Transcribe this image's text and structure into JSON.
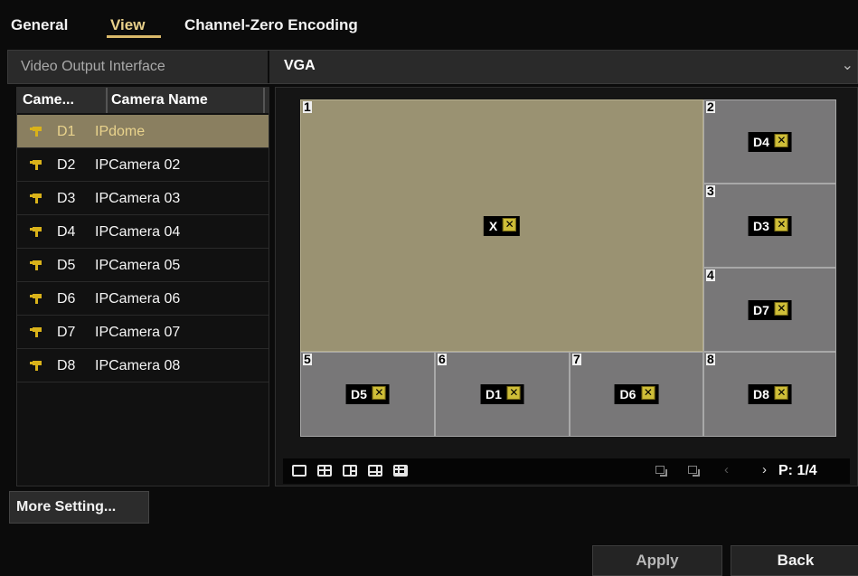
{
  "tabs": [
    {
      "label": "General"
    },
    {
      "label": "View"
    },
    {
      "label": "Channel-Zero Encoding"
    }
  ],
  "output": {
    "label": "Video Output Interface",
    "value": "VGA"
  },
  "camera_table": {
    "col_id": "Came...",
    "col_name": "Camera Name",
    "rows": [
      {
        "id": "D1",
        "name": "IPdome"
      },
      {
        "id": "D2",
        "name": "IPCamera 02"
      },
      {
        "id": "D3",
        "name": "IPCamera 03"
      },
      {
        "id": "D4",
        "name": "IPCamera 04"
      },
      {
        "id": "D5",
        "name": "IPCamera 05"
      },
      {
        "id": "D6",
        "name": "IPCamera 06"
      },
      {
        "id": "D7",
        "name": "IPCamera 07"
      },
      {
        "id": "D8",
        "name": "IPCamera 08"
      }
    ],
    "selected_index": 0
  },
  "layout_windows": [
    {
      "num": "1",
      "camera": "X"
    },
    {
      "num": "2",
      "camera": "D4"
    },
    {
      "num": "3",
      "camera": "D3"
    },
    {
      "num": "4",
      "camera": "D7"
    },
    {
      "num": "5",
      "camera": "D5"
    },
    {
      "num": "6",
      "camera": "D1"
    },
    {
      "num": "7",
      "camera": "D6"
    },
    {
      "num": "8",
      "camera": "D8"
    }
  ],
  "pager": {
    "label": "P: 1/4"
  },
  "buttons": {
    "more_setting": "More Setting...",
    "apply": "Apply",
    "back": "Back"
  },
  "icons": {
    "camera": "camera-icon",
    "remove": "remove-x-icon",
    "chevron": "chevron-down-icon"
  },
  "colors": {
    "active_tab": "#e8d08a",
    "selected_row": "#8a7f60",
    "main_window": "#9a9272",
    "window": "#787778",
    "camera_icon": "#d9b21a"
  }
}
